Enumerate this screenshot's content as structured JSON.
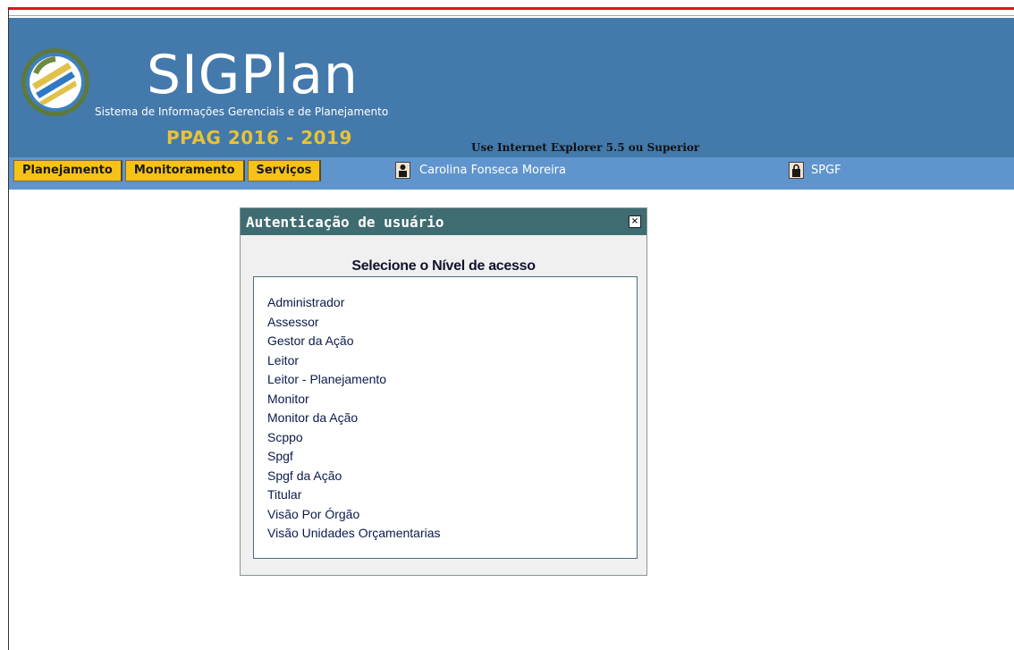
{
  "brand": {
    "title": "SIGPlan",
    "subtitle": "Sistema de Informações Gerenciais e de Planejamento",
    "period": "PPAG 2016 - 2019",
    "browser_note": "Use Internet Explorer 5.5 ou Superior",
    "logo_icon": "sigplan-logo-icon"
  },
  "menu": {
    "tabs": [
      {
        "label": "Planejamento"
      },
      {
        "label": "Monitoramento"
      },
      {
        "label": "Serviços"
      }
    ],
    "user_name": "Carolina Fonseca Moreira",
    "org": "SPGF",
    "user_icon": "user-icon",
    "org_icon": "lock-icon"
  },
  "dialog": {
    "title": "Autenticação de usuário",
    "close_icon": "close-icon",
    "heading": "Selecione o Nível de acesso",
    "options": [
      "Administrador",
      "Assessor",
      "Gestor da Ação",
      "Leitor",
      "Leitor - Planejamento",
      "Monitor",
      "Monitor da Ação",
      "Scppo",
      "Spgf",
      "Spgf da Ação",
      "Titular",
      "Visão Por Órgão",
      "Visão Unidades Orçamentarias"
    ]
  },
  "colors": {
    "banner": "#4479ab",
    "menubar": "#5f95cc",
    "tab": "#f7c217",
    "dialog_title": "#3f6c70",
    "top_line": "#e8101a"
  }
}
